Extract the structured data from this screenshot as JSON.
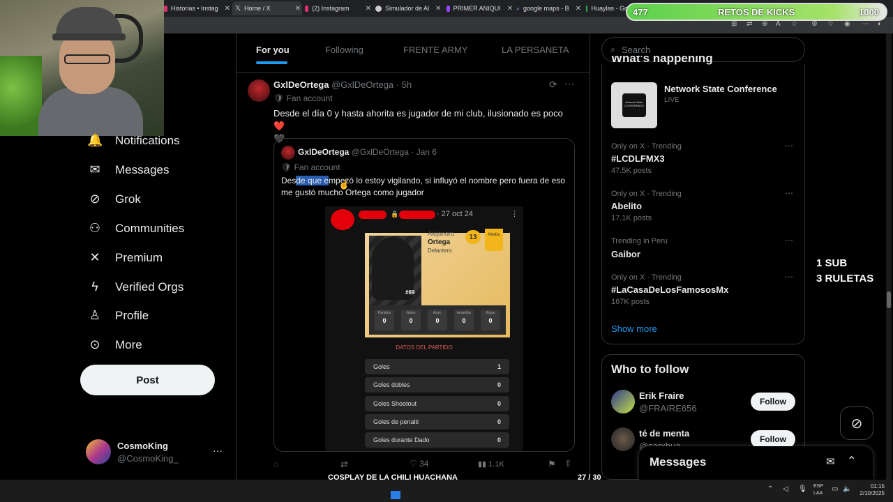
{
  "browser": {
    "tabs": [
      {
        "label": "Historias • Instag",
        "color": "#e1306c"
      },
      {
        "label": "Home / X",
        "color": "#ffffff"
      },
      {
        "label": "(2) Instagram",
        "color": "#e1306c"
      },
      {
        "label": "Simulador de Al",
        "color": "#cccccc"
      },
      {
        "label": "PRIMER ANIQUI",
        "color": "#9146ff"
      },
      {
        "label": "google maps - B",
        "color": "#4285f4"
      },
      {
        "label": "Huaylas - Go",
        "color": "#34a853"
      }
    ]
  },
  "nav": {
    "items": [
      {
        "label": "Notifications",
        "icon": "bell-icon",
        "glyph": "🔔"
      },
      {
        "label": "Messages",
        "icon": "envelope-icon",
        "glyph": "✉"
      },
      {
        "label": "Grok",
        "icon": "grok-icon",
        "glyph": "⊘"
      },
      {
        "label": "Communities",
        "icon": "communities-icon",
        "glyph": "👥"
      },
      {
        "label": "Premium",
        "icon": "x-logo-icon",
        "glyph": "𝕏"
      },
      {
        "label": "Verified Orgs",
        "icon": "lightning-icon",
        "glyph": "ϟ"
      },
      {
        "label": "Profile",
        "icon": "person-icon",
        "glyph": "👤"
      },
      {
        "label": "More",
        "icon": "more-circle-icon",
        "glyph": "⋯"
      }
    ],
    "post_label": "Post"
  },
  "account": {
    "name": "CosmoKing",
    "handle": "@CosmoKing_",
    "more": "···"
  },
  "feed": {
    "tabs": [
      "For you",
      "Following",
      "FRENTE ARMY",
      "LA PERSANETA"
    ]
  },
  "post": {
    "author": "GxlDeOrtega",
    "handle": "@GxlDeOrtega",
    "time": "5h",
    "badge": "Fan account",
    "text": "Desde el día 0 y hasta ahorita es jugador de mi club, ilusionado es poco ❤️",
    "text2": "🖤",
    "stats": {
      "replies": "",
      "reposts": "",
      "likes": "34",
      "views": "1.1K"
    }
  },
  "quote": {
    "author": "GxlDeOrtega",
    "handle": "@GxlDeOrtega",
    "time": "Jan 6",
    "badge": "Fan account",
    "text_pre": "Des",
    "text_highlight": "de que e",
    "text_post": "mpezó lo estoy vigilando, si influyó el nombre pero fuera de eso me gustó mucho Ortega como jugador",
    "image": {
      "date": "· 27 oct 24",
      "player_name": "Alejandro Ortega",
      "position": "Delantero",
      "rating": "13",
      "media": "Media",
      "number": "#69",
      "stat_labels": [
        "Partidos",
        "Goles",
        "Asist.",
        "Amarillas",
        "Rojas"
      ],
      "stat_values": [
        "0",
        "0",
        "0",
        "0",
        "0"
      ],
      "section_title": "DATOS DEL PARTIDO",
      "rows": [
        {
          "label": "Goles",
          "value": "1"
        },
        {
          "label": "Goles dobles",
          "value": "0"
        },
        {
          "label": "Goles Shootout",
          "value": "0"
        },
        {
          "label": "Goles de penalti",
          "value": "0"
        },
        {
          "label": "Goles durante Dado",
          "value": "0"
        }
      ]
    }
  },
  "search": {
    "placeholder": "Search"
  },
  "trends": {
    "header": "What's happening",
    "live": {
      "name": "Network State Conference",
      "status": "LIVE"
    },
    "items": [
      {
        "meta": "Only on X · Trending",
        "name": "#LCDLFMX3",
        "count": "47.5K posts"
      },
      {
        "meta": "Only on X · Trending",
        "name": "Abelito",
        "count": "17.1K posts"
      },
      {
        "meta": "Trending in Peru",
        "name": "Gaibor",
        "count": ""
      },
      {
        "meta": "Only on X · Trending",
        "name": "#LaCasaDeLosFamososMx",
        "count": "167K posts"
      }
    ],
    "show_more": "Show more"
  },
  "who_to_follow": {
    "title": "Who to follow",
    "users": [
      {
        "name": "Erik Fraire",
        "handle": "@FRAIRE656",
        "button": "Follow"
      },
      {
        "name": "té de menta",
        "handle": "@sarxhua",
        "button": "Follow"
      }
    ]
  },
  "messages_drawer": {
    "title": "Messages"
  },
  "overlay": {
    "retos_left": "477",
    "retos_title": "RETOS DE KICKS",
    "retos_right": "1000",
    "retos_progress": 0.477,
    "sub_line1": "1 SUB",
    "sub_line2": "3 RULETAS",
    "cosplay_title": "COSPLAY DE LA CHILI HUACHANA",
    "cosplay_count": "27 / 30",
    "cosplay_progress": 0.9
  },
  "taskbar": {
    "lang1": "ESP",
    "lang2": "LAA",
    "time": "01:15",
    "date": "2/10/2025"
  }
}
